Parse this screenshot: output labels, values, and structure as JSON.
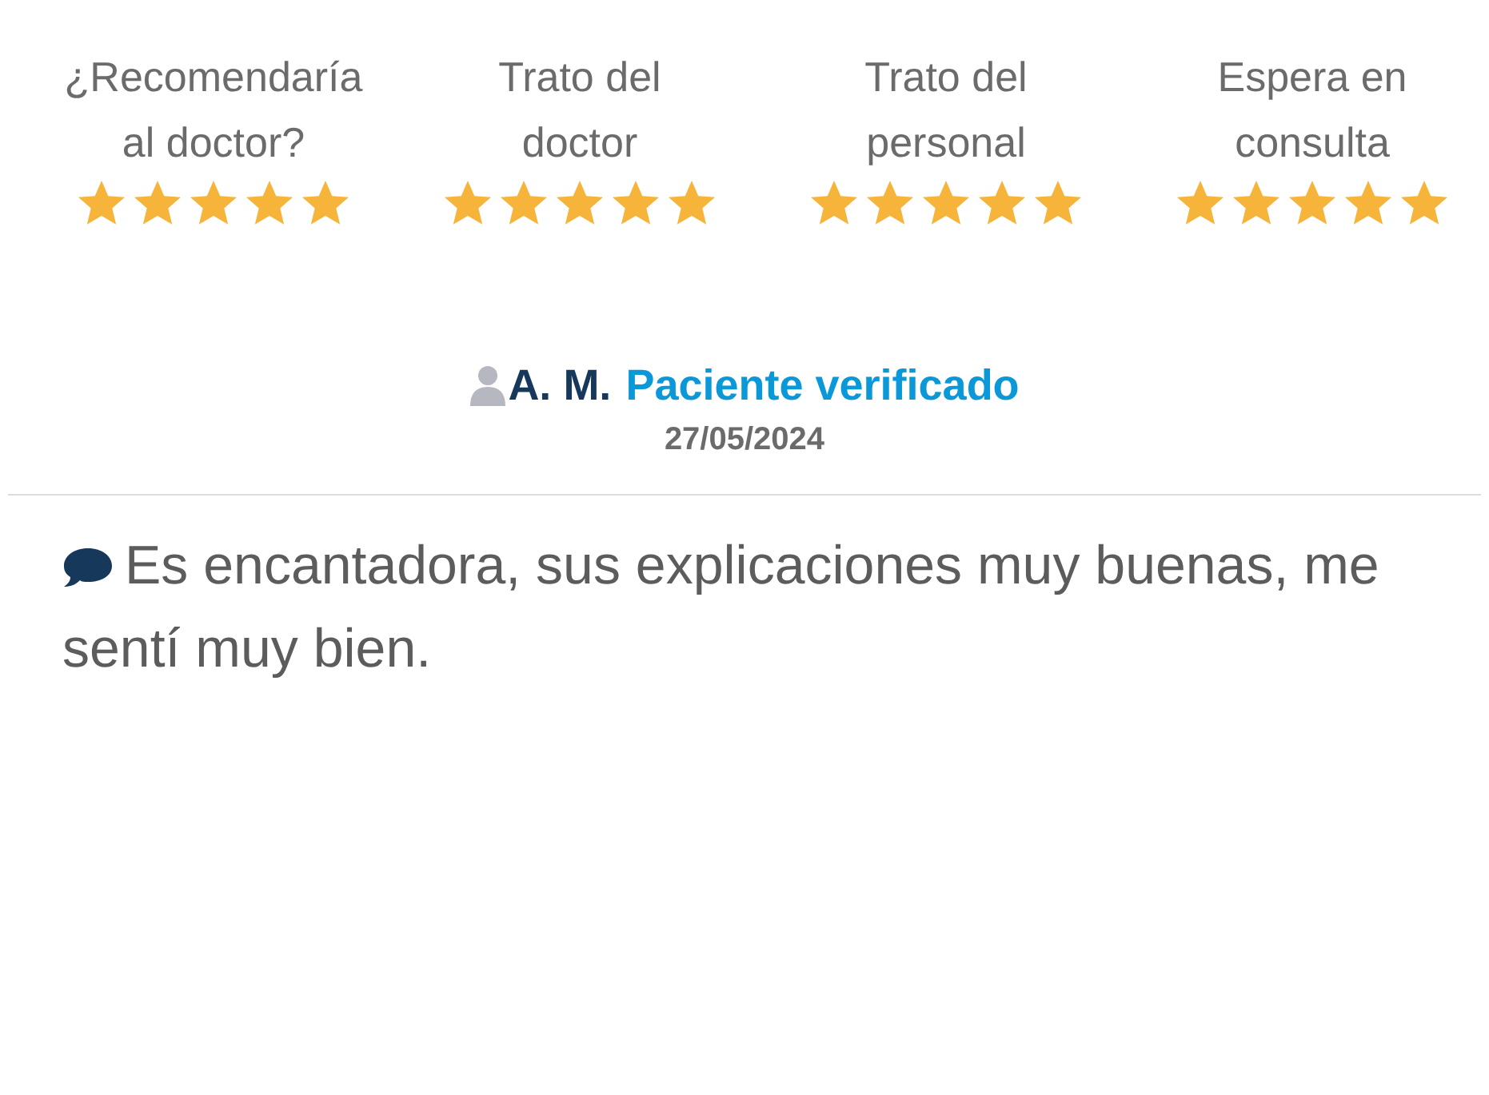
{
  "ratings": [
    {
      "label": "¿Recomendaría al doctor?",
      "stars": 5
    },
    {
      "label": "Trato del doctor",
      "stars": 5
    },
    {
      "label": "Trato del personal",
      "stars": 5
    },
    {
      "label": "Espera en consulta",
      "stars": 5
    }
  ],
  "review": {
    "author": "A. M.",
    "badge": "Paciente verificado",
    "date": "27/05/2024",
    "comment": "Es encantadora, sus explicaciones muy buenas, me sentí muy bien."
  }
}
